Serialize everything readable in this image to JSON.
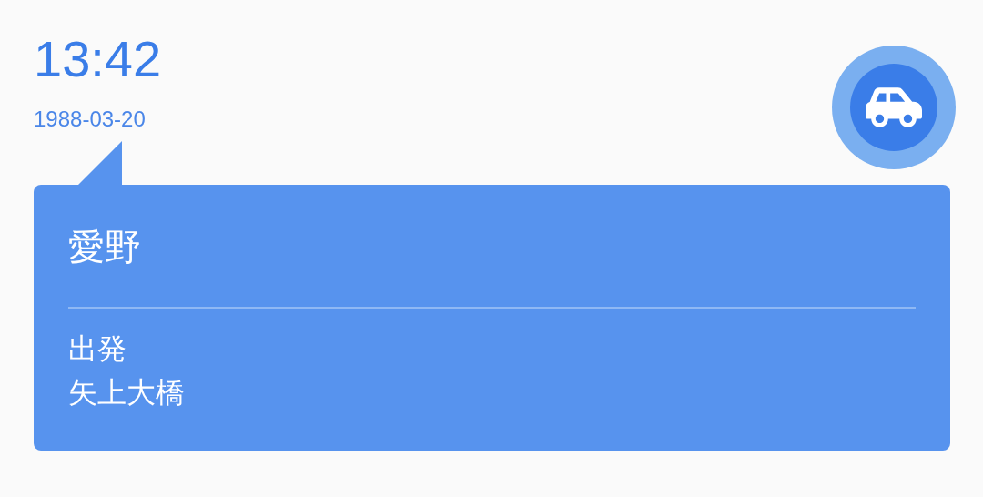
{
  "time": "13:42",
  "date": "1988-03-20",
  "card": {
    "title": "愛野",
    "event": "出発",
    "place": "矢上大橋"
  }
}
